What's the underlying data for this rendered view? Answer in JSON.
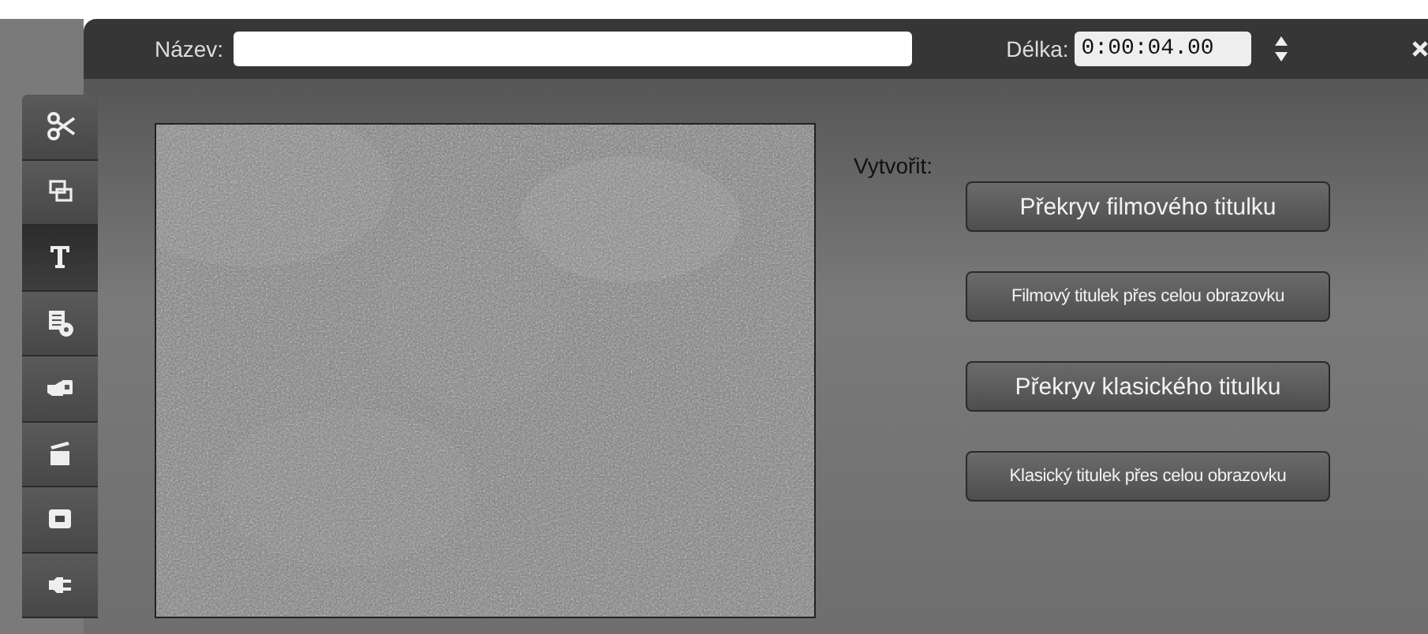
{
  "header": {
    "name_label": "Název:",
    "length_label": "Délka:",
    "length_value": "0:00:04.00"
  },
  "tabs": [
    {
      "selected": false
    },
    {
      "selected": false
    },
    {
      "selected": true
    },
    {
      "selected": false
    },
    {
      "selected": false
    },
    {
      "selected": false
    },
    {
      "selected": false
    },
    {
      "selected": false
    }
  ],
  "create": {
    "label": "Vytvořit:",
    "buttons": [
      {
        "label": "Překryv filmového titulku",
        "kind": "large"
      },
      {
        "label": "Filmový titulek přes celou obrazovku",
        "kind": "small"
      },
      {
        "label": "Překryv klasického titulku",
        "kind": "large"
      },
      {
        "label": "Klasický titulek přes celou obrazovku",
        "kind": "small"
      }
    ]
  }
}
